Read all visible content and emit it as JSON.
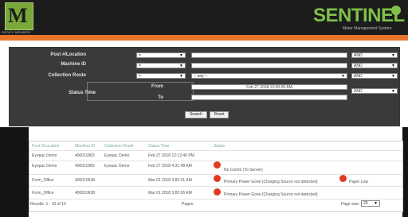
{
  "logo": {
    "caption": "REDDY MEMBER"
  },
  "brand": {
    "title": "SENTINEL",
    "subtitle": "Motor Management System"
  },
  "form": {
    "post_location_label": "Post #/Location",
    "machine_id_label": "Machine ID",
    "collection_route_label": "Collection Route",
    "status_time_label": "Status Time",
    "from_label": "From",
    "to_label": "To",
    "op1": "=",
    "op2": "=",
    "op3": "=",
    "route_value": "-- any --",
    "from_value": "Feb 27 2018 12:00:00 AM",
    "to_value": "",
    "and1": "AND",
    "and2": "AND",
    "and3": "AND",
    "and4": "AND",
    "search_label": "Search",
    "reset_label": "Reset"
  },
  "table": {
    "headers": [
      "Post #/Location",
      "Machine ID",
      "Collection Route",
      "Status Time",
      "Status"
    ],
    "rows": [
      {
        "location": "Eyepac Demo",
        "machine": "400011883",
        "route": "Eyepac Demo",
        "time": "Feb 27 2018 12:12:40 PM",
        "status": "",
        "status2": ""
      },
      {
        "location": "Eyepac Demo",
        "machine": "400011883",
        "route": "Eyepac Demo",
        "time": "Feb 27 2018 4:31:48 AM",
        "status": "No Comm (To Server)",
        "status2": ""
      },
      {
        "location": "Form_Office",
        "machine": "400010638",
        "route": "",
        "time": "Mar 01 2018 3:82:31 AM",
        "status": "Primary Power Gone (Charging Source not detected)",
        "status2": "Paper Low"
      },
      {
        "location": "Form_Office",
        "machine": "400010638",
        "route": "",
        "time": "Mar 01 2018 3:82:06 AM",
        "status": "Primary Power Gone (Charging Source not detected)",
        "status2": ""
      }
    ],
    "results_text": "Results: 1 - 10 of 10",
    "pages_label": "Pages:",
    "page_size_label": "Page size:",
    "page_size_value": "20"
  },
  "colors": {
    "accent_orange": "#e8772b",
    "brand_green": "#7ec04a",
    "status_red": "#e23a22"
  }
}
